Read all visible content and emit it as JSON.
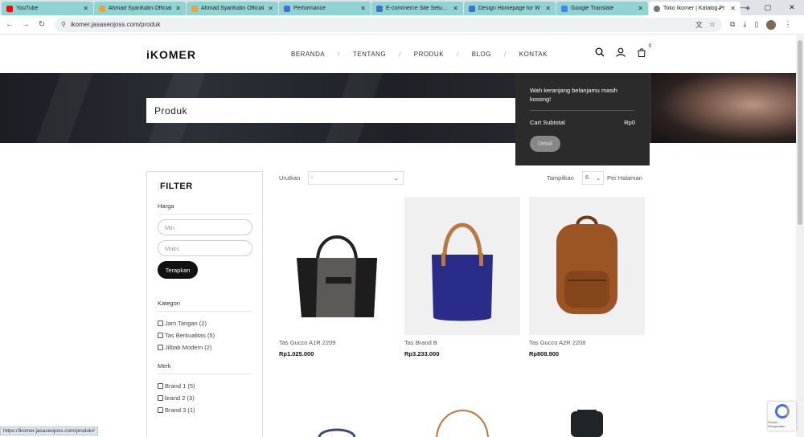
{
  "browser": {
    "tabs": [
      {
        "label": "YouTube",
        "color": "#ff0000"
      },
      {
        "label": "Ahmad Syarifudin Official",
        "color": "#e8a33a"
      },
      {
        "label": "Ahmad Syarifudin Official",
        "color": "#e8a33a"
      },
      {
        "label": "Performance",
        "color": "#4a6cd4"
      },
      {
        "label": "E-commerce Site Setup fo",
        "color": "#3b73c9"
      },
      {
        "label": "Design Homepage for W",
        "color": "#3b73c9"
      },
      {
        "label": "Google Translate",
        "color": "#4285f4"
      },
      {
        "label": "Toko Ikomer | Katalog Pr",
        "color": "#777777"
      }
    ],
    "url": "ikomer.jasaseojoss.com/produk",
    "status_url": "https://ikomer.jasaseojoss.com/produk#"
  },
  "site": {
    "logo": "iKOMER",
    "nav": [
      "BERANDA",
      "TENTANG",
      "PRODUK",
      "BLOG",
      "KONTAK"
    ],
    "nav_sep": "/",
    "cart_count": "0",
    "page_title": "Produk"
  },
  "cart_dropdown": {
    "message": "Wah keranjang belanjamu masih kosong!",
    "subtotal_label": "Cart Subtotal",
    "subtotal_value": "Rp0",
    "detail_button": "Detail"
  },
  "filter": {
    "title": "FILTER",
    "price_label": "Harga",
    "min_placeholder": "Min",
    "max_placeholder": "Maks",
    "apply_button": "Terapkan",
    "category_label": "Kategori",
    "categories": [
      "Jam Tangan (2)",
      "Tas Berkualitas (5)",
      "Jilbab Modern (2)"
    ],
    "brand_label": "Merk",
    "brands": [
      "Brand 1 (5)",
      "brand 2 (3)",
      "Brand 3 (1)"
    ]
  },
  "toolbar": {
    "sort_label": "Urutkan",
    "sort_value": "-",
    "show_label": "Tampilkan",
    "show_value": "6",
    "per_page": "Per Halaman"
  },
  "products": [
    {
      "name": "Tas Gucco A1R 2209",
      "price": "Rp1.025.000"
    },
    {
      "name": "Tas Brand B",
      "price": "Rp3.233.000"
    },
    {
      "name": "Tas Gucco A2R 2208",
      "price": "Rp808.900"
    }
  ],
  "recaptcha_text": "Privasi - Persyaratan"
}
